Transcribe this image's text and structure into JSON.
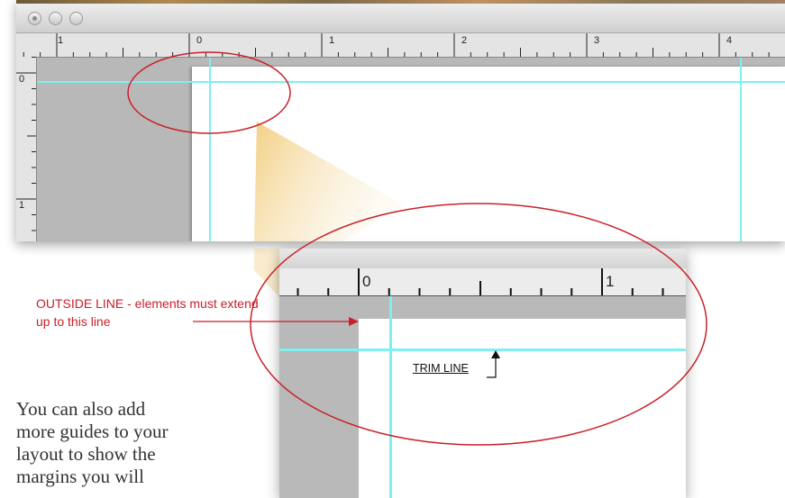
{
  "top_window": {
    "ruler_labels": [
      "1",
      "0",
      "1",
      "2",
      "3",
      "4"
    ],
    "vruler_labels": [
      "0",
      "1"
    ]
  },
  "zoom_view": {
    "ruler_labels": [
      "0",
      "1"
    ]
  },
  "annotations": {
    "outside_line": "OUTSIDE LINE - elements must extend up to this line",
    "trim_line": "TRIM LINE"
  },
  "body_text": "You can also add more guides to your layout to show the margins you will",
  "colors": {
    "guide": "#7ff0f0",
    "annotation_red": "#c8202a",
    "pasteboard": "#b8b8b8"
  }
}
